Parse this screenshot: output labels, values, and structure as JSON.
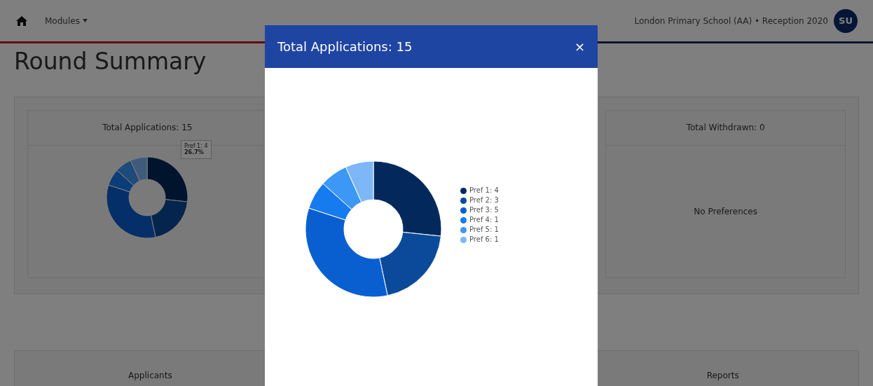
{
  "navbar": {
    "modules_menu": "Modules",
    "context": "London Primary School (AA) • Reception 2020",
    "avatar": "SU"
  },
  "page_title": "Round Summary",
  "summary_cards": [
    {
      "title": "Total Applications: 15",
      "kind": "chart",
      "tooltip": {
        "label": "Pref 1: 4",
        "percent": "26.7%"
      }
    },
    {
      "title": "Total Withdrawn: 0",
      "kind": "empty",
      "message": "No Preferences"
    }
  ],
  "bottom_cards": [
    "Applicants",
    "Reports"
  ],
  "modal": {
    "title": "Total Applications: 15",
    "close": "×",
    "chart_data": {
      "type": "donut",
      "categories": [
        "Pref 1: 4",
        "Pref 2: 3",
        "Pref 3: 5",
        "Pref 4: 1",
        "Pref 5: 1",
        "Pref 6: 1"
      ],
      "values": [
        4,
        3,
        5,
        1,
        1,
        1
      ],
      "legend": "right"
    },
    "legend": [
      {
        "color": "#03295c"
      },
      {
        "color": "#0b4a9b"
      },
      {
        "color": "#0a5fd0"
      },
      {
        "color": "#167bef"
      },
      {
        "color": "#3d97f5"
      },
      {
        "color": "#7db7f7"
      }
    ]
  }
}
